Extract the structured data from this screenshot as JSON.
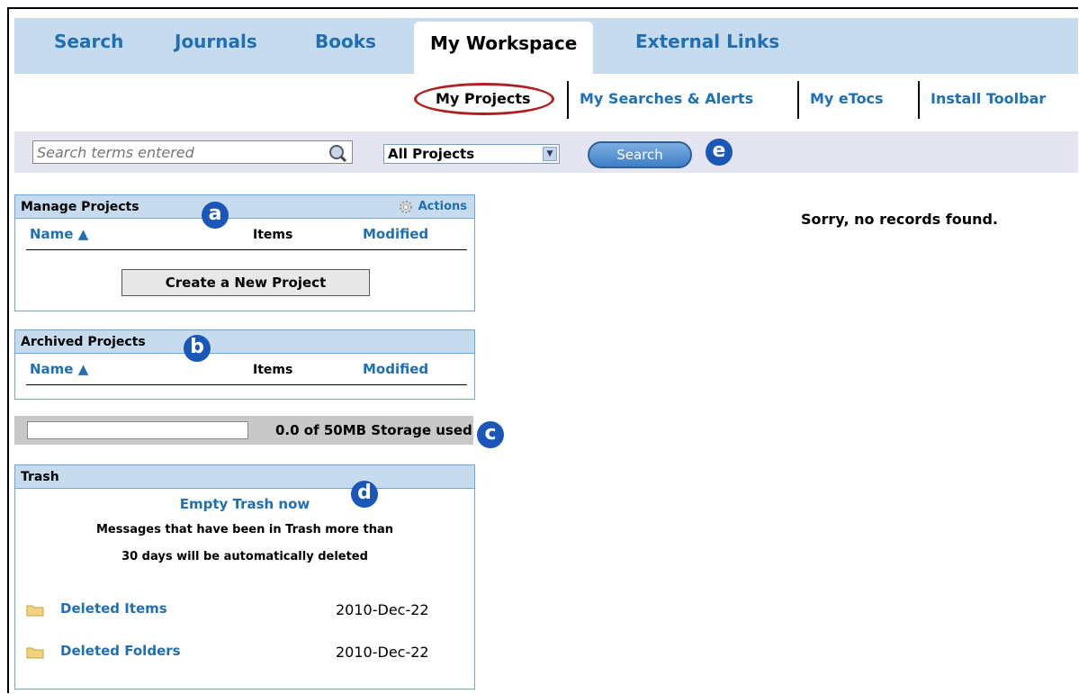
{
  "tabs": [
    "Search",
    "Journals",
    "Books",
    "My Workspace",
    "External Links"
  ],
  "subnav": [
    "My Projects",
    "My Searches & Alerts",
    "My eTocs",
    "Install Toolbar"
  ],
  "search": {
    "placeholder": "Search terms entered",
    "scope": "All Projects",
    "button": "Search"
  },
  "badges": {
    "a": "a",
    "b": "b",
    "c": "c",
    "d": "d",
    "e": "e"
  },
  "manage": {
    "title": "Manage Projects",
    "actions": "Actions",
    "col_name": "Name ▲",
    "col_items": "Items",
    "col_modified": "Modified",
    "create_button": "Create a New Project"
  },
  "archived": {
    "title": "Archived Projects",
    "col_name": "Name ▲",
    "col_items": "Items",
    "col_modified": "Modified"
  },
  "storage": {
    "label": "0.0 of 50MB Storage used",
    "used_fraction": 0
  },
  "trash": {
    "title": "Trash",
    "empty_link": "Empty Trash now",
    "message_line1": "Messages that have been in Trash more than",
    "message_line2": "30 days will be automatically deleted",
    "items": [
      {
        "label": "Deleted Items",
        "date": "2010-Dec-22"
      },
      {
        "label": "Deleted Folders",
        "date": "2010-Dec-22"
      }
    ]
  },
  "results_message": "Sorry, no records found.",
  "colors": {
    "tab_bar": "#c6dcee",
    "link": "#1f6fb4",
    "badge": "#1a57b8",
    "highlight_ring": "#b02020"
  }
}
